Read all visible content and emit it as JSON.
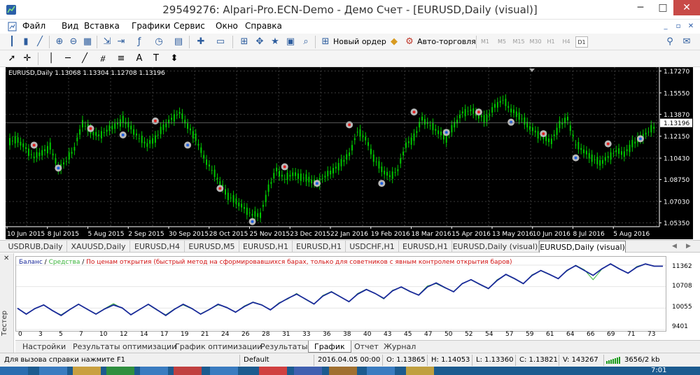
{
  "window": {
    "title": "29549276: Alpari-Pro.ECN-Demo - Демо Счет - [EURUSD,Daily (visual)]",
    "min_glyph": "─",
    "max_glyph": "□",
    "close_glyph": "✕"
  },
  "menu": {
    "items": [
      "Файл",
      "Вид",
      "Вставка",
      "Графики",
      "Сервис",
      "Окно",
      "Справка"
    ],
    "mdi": [
      "_",
      "▫",
      "✕"
    ]
  },
  "toolbar1": {
    "new_order_label": "Новый ордер",
    "autotrade_label": "Авто-торговля",
    "timeframes": [
      "M1",
      "M5",
      "M15",
      "M30",
      "H1",
      "H4",
      "D1"
    ],
    "active_timeframe": "D1"
  },
  "chart": {
    "info_text": "EURUSD,Daily  1.13068 1.13304 1.12708 1.13196",
    "current_price": "1.13196",
    "colors": {
      "background": "#000000",
      "candles": "#00c800",
      "grid": "#3a3a3a",
      "text": "#ffffff"
    }
  },
  "chart_data": [
    {
      "type": "line",
      "symbol": "EURUSD",
      "timeframe": "Daily",
      "x": [
        "10 Jun 2015",
        "8 Jul 2015",
        "5 Aug 2015",
        "2 Sep 2015",
        "30 Sep 2015",
        "28 Oct 2015",
        "25 Nov 2015",
        "23 Dec 2015",
        "22 Jan 2016",
        "19 Feb 2016",
        "18 Mar 2016",
        "15 Apr 2016",
        "13 May 2016",
        "10 Jun 2016",
        "8 Jul 2016",
        "5 Aug 2016"
      ],
      "y_ticks": [
        "1.17270",
        "1.15550",
        "1.13870",
        "1.13196",
        "1.12150",
        "1.10430",
        "1.08750",
        "1.07030",
        "1.05350"
      ],
      "ylim": [
        1.0505,
        1.1757
      ],
      "series": [
        {
          "values": [
            1.118,
            1.112,
            1.105,
            1.109,
            1.113,
            1.096,
            1.102,
            1.112,
            1.132,
            1.125,
            1.122,
            1.126,
            1.13,
            1.134,
            1.128,
            1.12,
            1.115,
            1.12,
            1.128,
            1.135,
            1.14,
            1.13,
            1.12,
            1.105,
            1.095,
            1.085,
            1.075,
            1.07,
            1.065,
            1.06,
            1.06,
            1.08,
            1.095,
            1.088,
            1.092,
            1.09,
            1.087,
            1.085,
            1.09,
            1.095,
            1.1,
            1.107,
            1.125,
            1.12,
            1.105,
            1.095,
            1.09,
            1.095,
            1.115,
            1.12,
            1.135,
            1.13,
            1.125,
            1.12,
            1.13,
            1.14,
            1.142,
            1.138,
            1.135,
            1.145,
            1.15,
            1.142,
            1.138,
            1.13,
            1.125,
            1.12,
            1.118,
            1.13,
            1.135,
            1.115,
            1.11,
            1.105,
            1.1,
            1.105,
            1.11,
            1.108,
            1.115,
            1.12,
            1.125,
            1.13
          ]
        }
      ]
    },
    {
      "type": "line",
      "legend": [
        "Баланс",
        "Средства",
        "По ценам открытия (быстрый метод на сформировавшихся барах, только для советников с явным контролем открытия баров)"
      ],
      "x_ticks": [
        "0",
        "3",
        "5",
        "7",
        "10",
        "12",
        "14",
        "17",
        "19",
        "21",
        "24",
        "26",
        "28",
        "31",
        "33",
        "36",
        "38",
        "40",
        "43",
        "45",
        "47",
        "50",
        "52",
        "54",
        "57",
        "59",
        "61",
        "64",
        "66",
        "69",
        "71",
        "73"
      ],
      "y_ticks": [
        "11362",
        "10708",
        "10055",
        "9401"
      ],
      "ylim": [
        9401,
        11490
      ],
      "series": [
        {
          "name": "Баланс",
          "values": [
            10050,
            9870,
            10040,
            10150,
            9980,
            9830,
            10010,
            10170,
            10020,
            9870,
            10030,
            10150,
            10060,
            9850,
            10010,
            10170,
            10000,
            9830,
            10020,
            10170,
            10040,
            9870,
            10010,
            10170,
            10070,
            9930,
            10100,
            10230,
            10150,
            10000,
            10200,
            10350,
            10480,
            10330,
            10180,
            10420,
            10550,
            10400,
            10250,
            10480,
            10620,
            10500,
            10350,
            10580,
            10700,
            10560,
            10450,
            10700,
            10820,
            10680,
            10550,
            10800,
            10920,
            10780,
            10650,
            10900,
            11080,
            10950,
            10800,
            11050,
            11200,
            11080,
            10950,
            11200,
            11350,
            11200,
            11050,
            11250,
            11400,
            11250,
            11120,
            11300,
            11400,
            11330,
            11330
          ]
        },
        {
          "name": "Средства",
          "values": [
            10050,
            9880,
            10030,
            10160,
            9970,
            9850,
            10020,
            10180,
            10010,
            9880,
            10040,
            10190,
            10050,
            9860,
            10020,
            10160,
            9990,
            9850,
            10030,
            10150,
            10030,
            9880,
            10020,
            10150,
            10080,
            9920,
            10120,
            10240,
            10160,
            10000,
            10220,
            10330,
            10500,
            10320,
            10170,
            10440,
            10560,
            10410,
            10240,
            10500,
            10630,
            10500,
            10330,
            10600,
            10690,
            10550,
            10460,
            10730,
            10800,
            10670,
            10560,
            10810,
            10910,
            10770,
            10640,
            10920,
            11070,
            10940,
            10790,
            11070,
            11190,
            11070,
            10960,
            11180,
            11360,
            11220,
            10920,
            11240,
            11410,
            11260,
            11110,
            11320,
            11400,
            11330,
            11330
          ]
        }
      ]
    }
  ],
  "chart_tabs": {
    "items": [
      "USDRUB,Daily",
      "XAUUSD,Daily",
      "EURUSD,H4",
      "EURUSD,M5",
      "EURUSD,H1",
      "EURUSD,H1",
      "USDCHF,H1",
      "EURUSD,H1",
      "EURUSD,Daily (visual)",
      "EURUSD,Daily (visual)"
    ],
    "active_index": 9,
    "scroll_left": "◀",
    "scroll_right": "▶"
  },
  "tester": {
    "side_label": "Тестер",
    "close_glyph": "✕",
    "legend_balance": "Баланс",
    "legend_equity": "Средства",
    "legend_sep": " / ",
    "legend_mode": "По ценам открытия (быстрый метод на сформировавшихся барах, только для советников с явным контролем открытия баров)",
    "colors": {
      "balance": "#1a2a9a",
      "equity": "#3cb43c",
      "mode": "#d01010"
    },
    "tabs": [
      "Настройки",
      "Результаты оптимизации",
      "График оптимизации",
      "Результаты",
      "График",
      "Отчет",
      "Журнал"
    ],
    "active_tab": "График"
  },
  "status": {
    "help": "Для вызова справки нажмите F1",
    "profile": "Default",
    "datetime": "2016.04.05 00:00",
    "open": "O: 1.13865",
    "high": "H: 1.14053",
    "low": "L: 1.13360",
    "close": "C: 1.13821",
    "volume": "V: 143267",
    "traffic": "3656/2 kb"
  },
  "taskbar": {
    "clock": "7:01"
  }
}
